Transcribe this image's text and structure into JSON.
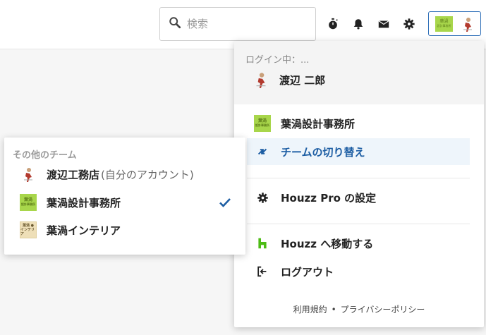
{
  "search": {
    "placeholder": "検索"
  },
  "topbar": {
    "icons": [
      "timer-icon",
      "bell-icon",
      "mail-icon",
      "gear-icon"
    ]
  },
  "colors": {
    "accent": "#1c5da3",
    "active_bg": "#eef5fb",
    "logo_green": "#a8d64b",
    "logo_beige": "#eedfb8",
    "houzz_green": "#4dbc15"
  },
  "brand": {
    "green_logo_line1": "葉渦",
    "green_logo_line2": "設計事務所",
    "beige_logo_line1": "葉渦 ●",
    "beige_logo_line2": "インテリア"
  },
  "dropdown": {
    "login_label": "ログイン中：...",
    "user_name": "渡辺 二郎",
    "current_team": "葉渦設計事務所",
    "switch_team": "チームの切り替え",
    "settings": "Houzz Pro の設定",
    "go_houzz": "Houzz へ移動する",
    "logout": "ログアウト",
    "footer_terms": "利用規約",
    "footer_dot": "•",
    "footer_privacy": "プライバシーポリシー"
  },
  "other_teams": {
    "title": "その他のチーム",
    "items": [
      {
        "label": "渡辺工務店",
        "suffix": "(自分のアカウント)",
        "selected": false
      },
      {
        "label": "葉渦設計事務所",
        "suffix": "",
        "selected": true
      },
      {
        "label": "葉渦インテリア",
        "suffix": "",
        "selected": false
      }
    ]
  }
}
